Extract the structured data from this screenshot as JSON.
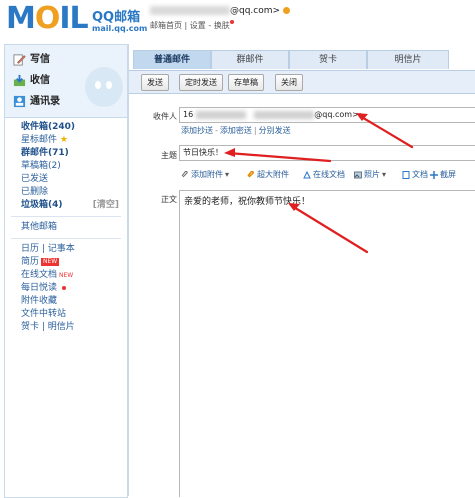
{
  "header": {
    "logo_text": "MOIL",
    "logo_cn": "QQ邮箱",
    "logo_domain": "mail.qq.com",
    "account_suffix": "@qq.com>",
    "links": [
      "邮箱首页",
      "设置",
      "换肤"
    ]
  },
  "sidebar": {
    "top_buttons": [
      {
        "label": "写信",
        "icon": "pencil-icon"
      },
      {
        "label": "收信",
        "icon": "inbox-icon"
      },
      {
        "label": "通讯录",
        "icon": "contacts-icon"
      }
    ],
    "folders": [
      {
        "label": "收件箱(240)",
        "bold": true
      },
      {
        "label": "星标邮件",
        "star": true
      },
      {
        "label": "群邮件(71)",
        "bold": true
      },
      {
        "label": "草稿箱(2)"
      },
      {
        "label": "已发送"
      },
      {
        "label": "已删除"
      },
      {
        "label": "垃圾箱(4)",
        "bold": true,
        "extra": "[清空]"
      }
    ],
    "other": [
      {
        "label": "其他邮箱"
      }
    ],
    "apps": [
      {
        "label": "日历 | 记事本"
      },
      {
        "label": "简历",
        "badge": "NEW"
      },
      {
        "label": "在线文档",
        "badge_text": "NEW"
      },
      {
        "label": "每日悦读"
      },
      {
        "label": "附件收藏"
      },
      {
        "label": "文件中转站"
      },
      {
        "label": "贺卡 | 明信片"
      }
    ]
  },
  "main": {
    "tabs": [
      "普通邮件",
      "群邮件",
      "贺卡",
      "明信片"
    ],
    "active_tab": 0,
    "toolbar": [
      "发送",
      "定时发送",
      "存草稿",
      "关闭"
    ],
    "recipient_label": "收件人",
    "recipient_value_start": "16",
    "recipient_value_end": "@qq.com>;",
    "recipient_links": [
      "添加抄送",
      "添加密送",
      "分别发送"
    ],
    "subject_label": "主题",
    "subject_value": "节日快乐！",
    "attach_bar": [
      "添加附件",
      "超大附件",
      "在线文档",
      "照片",
      "文档",
      "截屏"
    ],
    "body_label": "正文",
    "body_text": "亲爱的老师，祝你教师节快乐！"
  },
  "colors": {
    "brand_blue": "#2b78c5",
    "logo_orange": "#f0a020",
    "annotation_red": "#e02020",
    "toolbar_bg": "#e6eff9"
  }
}
